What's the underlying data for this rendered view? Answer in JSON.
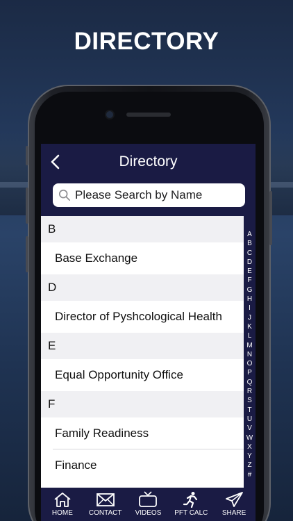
{
  "promo": {
    "headline": "DIRECTORY"
  },
  "navbar": {
    "title": "Directory",
    "back_icon": "chevron-left-icon"
  },
  "search": {
    "placeholder": "Please Search by Name",
    "icon": "search-icon"
  },
  "sections": [
    {
      "letter": "B",
      "items": [
        "Base Exchange"
      ]
    },
    {
      "letter": "D",
      "items": [
        "Director of Pyshcological Health"
      ]
    },
    {
      "letter": "E",
      "items": [
        "Equal Opportunity Office"
      ]
    },
    {
      "letter": "F",
      "items": [
        "Family Readiness",
        "Finance"
      ]
    }
  ],
  "index_letters": [
    "A",
    "B",
    "C",
    "D",
    "E",
    "F",
    "G",
    "H",
    "I",
    "J",
    "K",
    "L",
    "M",
    "N",
    "O",
    "P",
    "Q",
    "R",
    "S",
    "T",
    "U",
    "V",
    "W",
    "X",
    "Y",
    "Z",
    "#"
  ],
  "tabs": [
    {
      "label": "HOME",
      "icon": "home-icon"
    },
    {
      "label": "CONTACT",
      "icon": "envelope-icon"
    },
    {
      "label": "VIDEOS",
      "icon": "tv-icon"
    },
    {
      "label": "PFT CALC",
      "icon": "runner-icon"
    },
    {
      "label": "SHARE",
      "icon": "paper-plane-icon"
    }
  ],
  "colors": {
    "nav_bg": "#1a1b44",
    "section_bg": "#f0f0f3",
    "text": "#111111"
  }
}
